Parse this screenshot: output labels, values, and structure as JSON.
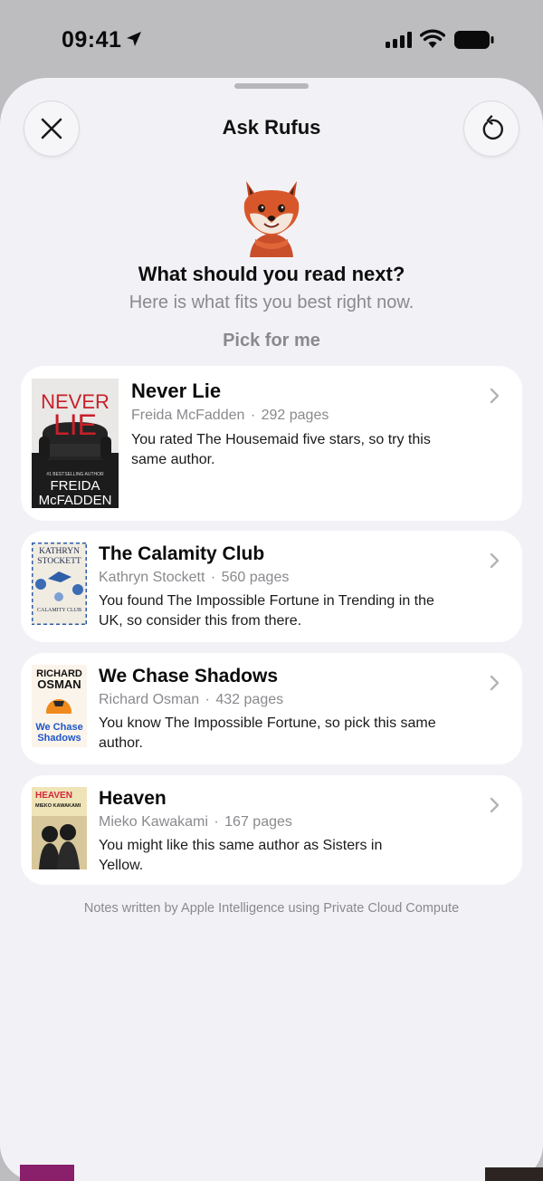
{
  "status_bar": {
    "time": "09:41"
  },
  "sheet": {
    "title": "Ask Rufus",
    "heading": "What should you read next?",
    "subheading": "Here is what fits you best right now.",
    "pick_button": "Pick for me",
    "footer": "Notes written by Apple Intelligence using Private Cloud Compute"
  },
  "books": [
    {
      "title": "Never Lie",
      "author": "Freida McFadden",
      "pages": "292 pages",
      "note": "You rated The Housemaid five stars, so try this same author.",
      "cover": {
        "line1": "NEVER",
        "line2": "LIE",
        "tag": "#1 BESTSELLING AUTHOR",
        "author1": "FREIDA",
        "author2": "McFADDEN"
      }
    },
    {
      "title": "The Calamity Club",
      "author": "Kathryn Stockett",
      "pages": "560 pages",
      "note": "You found The Impossible Fortune in Trending in the UK, so consider this from there.",
      "cover": {
        "line1": "KATHRYN",
        "line2": "STOCKETT",
        "line3": "CALAMITY CLUB"
      }
    },
    {
      "title": "We Chase Shadows",
      "author": "Richard Osman",
      "pages": "432 pages",
      "note": "You know The Impossible Fortune, so pick this same author.",
      "cover": {
        "line1": "RICHARD",
        "line2": "OSMAN",
        "line3": "We Chase",
        "line4": "Shadows"
      }
    },
    {
      "title": "Heaven",
      "author": "Mieko Kawakami",
      "pages": "167 pages",
      "note": "You might like this same author as Sisters in Yellow.",
      "cover": {
        "line1": "HEAVEN",
        "line2": "MIEKO KAWAKAMI"
      }
    }
  ],
  "colors": {
    "sheet_bg": "#f2f2f6",
    "card_bg": "#ffffff",
    "secondary_text": "#8a8a8e",
    "never_lie_red": "#c8202a"
  },
  "icons": [
    "location-arrow-icon",
    "cellular-signal-icon",
    "wifi-icon",
    "battery-icon",
    "close-icon",
    "refresh-icon",
    "fox-mascot",
    "chevron-right-icon"
  ]
}
